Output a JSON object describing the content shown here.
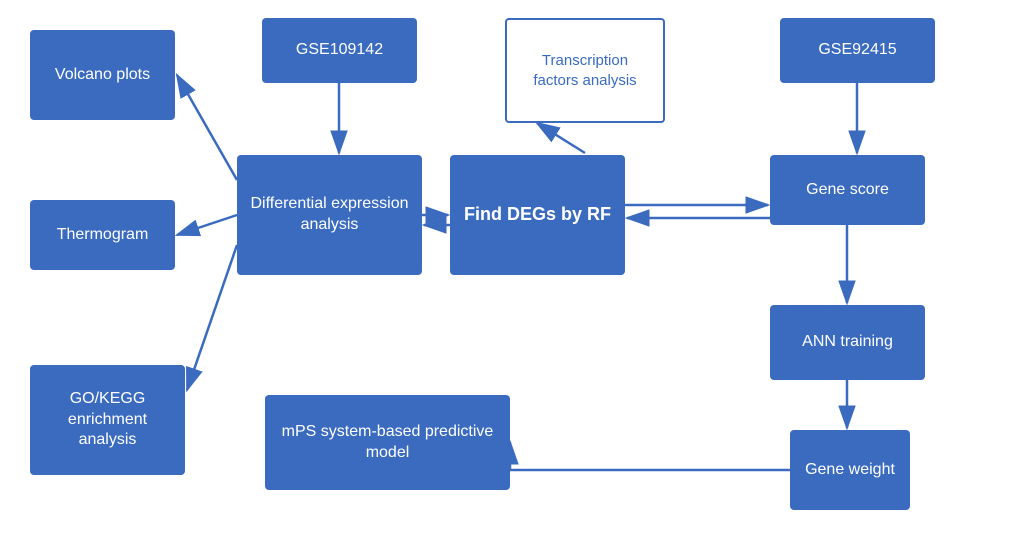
{
  "boxes": {
    "volcano_plots": {
      "label": "Volcano\nplots"
    },
    "thermogram": {
      "label": "Thermogram"
    },
    "gokegg": {
      "label": "GO/KEGG\nenrichment\nanalysis"
    },
    "gse109142": {
      "label": "GSE109142"
    },
    "diff_expr": {
      "label": "Differential\nexpression\nanalysis"
    },
    "find_degs": {
      "label": "Find DEGs\nby RF"
    },
    "transcription": {
      "label": "Transcription\nfactors\nanalysis"
    },
    "gse92415": {
      "label": "GSE92415"
    },
    "gene_score": {
      "label": "Gene score"
    },
    "ann_training": {
      "label": "ANN\ntraining"
    },
    "gene_weight": {
      "label": "Gene\nweight"
    },
    "mps_system": {
      "label": "mPS system-based\npredictive model"
    }
  },
  "arrow_color": "#3a6bbf"
}
